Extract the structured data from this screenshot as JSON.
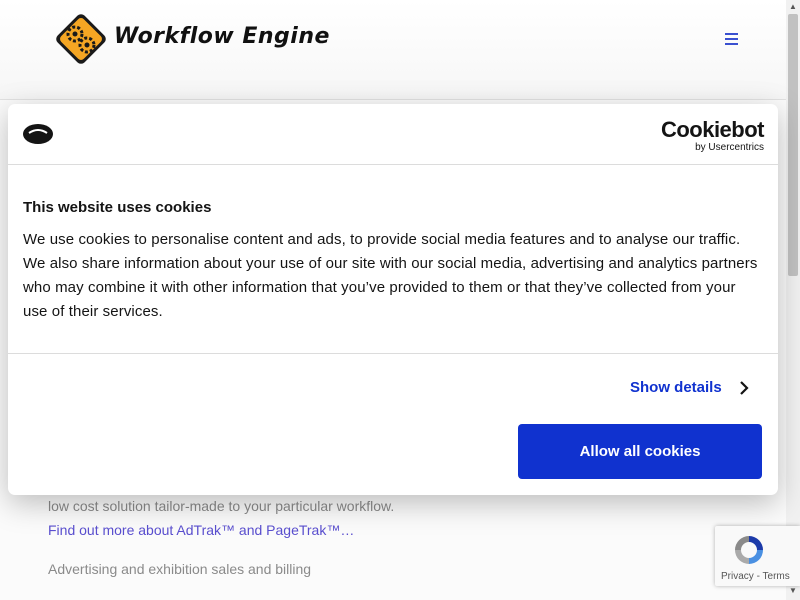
{
  "header": {
    "logo_text": "Workflow Engine",
    "menu_icon": "hamburger-icon"
  },
  "page": {
    "line1": "low cost solution tailor-made to your particular workflow.",
    "link": "Find out more about AdTrak™ and PageTrak™…",
    "line2": "Advertising and exhibition sales and billing"
  },
  "cookie_dialog": {
    "icon": "cookie-icon",
    "brand_name": "Cookiebot",
    "brand_sub": "by Usercentrics",
    "title": "This website uses cookies",
    "body": "We use cookies to personalise content and ads, to provide social media features and to analyse our traffic. We also share information about your use of our site with our social media, advertising and analytics partners who may combine it with other information that you’ve provided to them or that they’ve collected from your use of their services.",
    "show_details": "Show details",
    "allow_all": "Allow all cookies"
  },
  "recaptcha": {
    "privacy": "Privacy",
    "separator": "-",
    "terms": "Terms"
  },
  "colors": {
    "accent_blue": "#1032cf",
    "link_purple": "#5a4fcf",
    "logo_orange": "#f5a623"
  }
}
